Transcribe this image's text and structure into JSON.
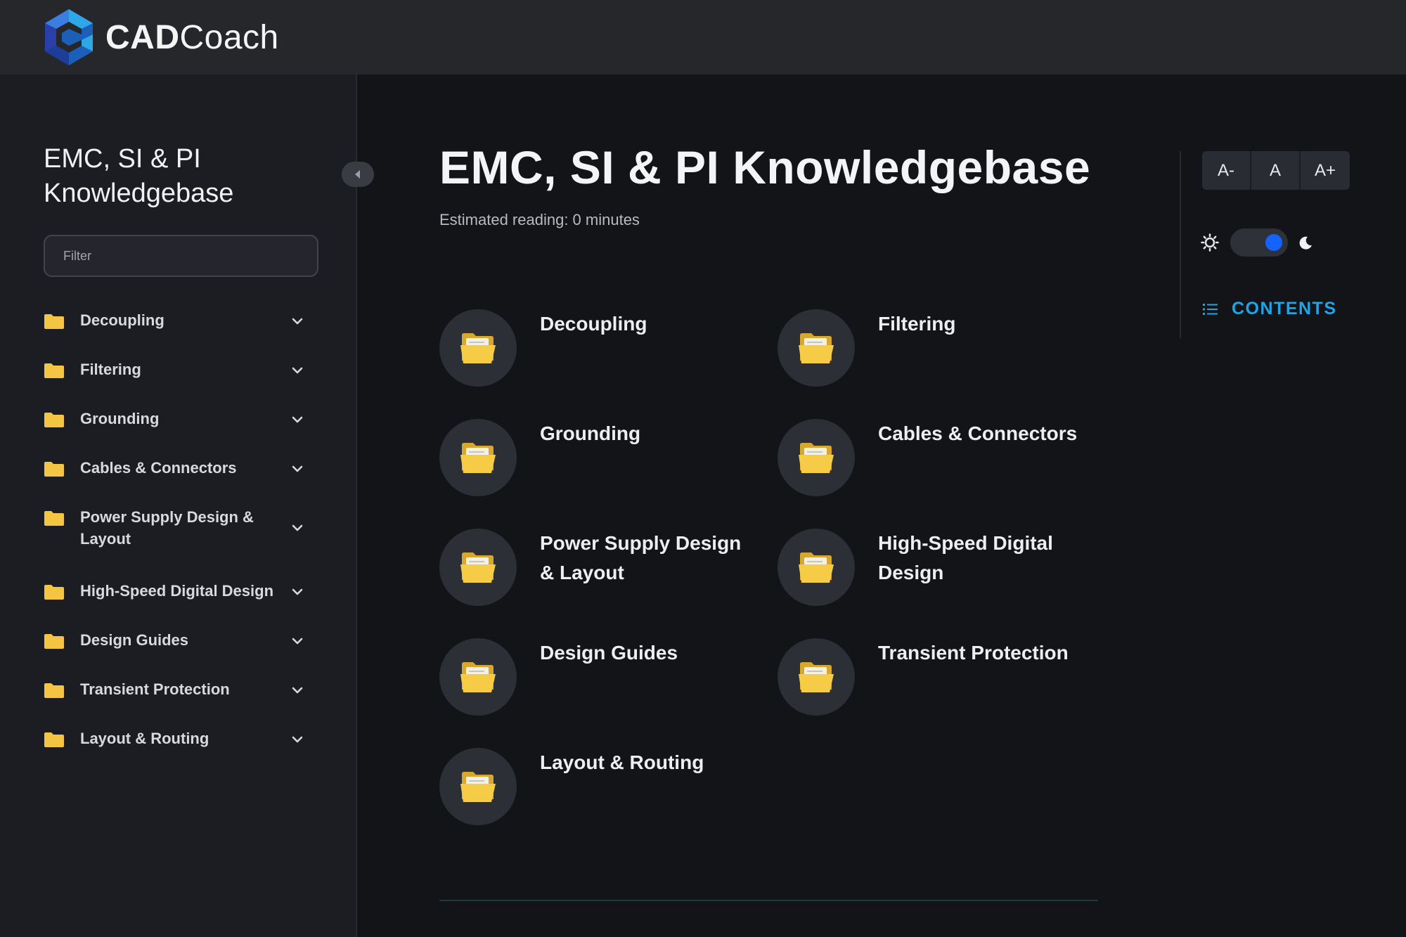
{
  "app": {
    "brand_bold": "CAD",
    "brand_light": "Coach"
  },
  "sidebar": {
    "title": "EMC, SI & PI Knowledgebase",
    "filter_placeholder": "Filter",
    "filter_value": "",
    "items": [
      {
        "label": "Decoupling"
      },
      {
        "label": "Filtering"
      },
      {
        "label": "Grounding"
      },
      {
        "label": "Cables & Connectors"
      },
      {
        "label": "Power Supply Design & Layout"
      },
      {
        "label": "High-Speed Digital Design"
      },
      {
        "label": "Design Guides"
      },
      {
        "label": "Transient Protection"
      },
      {
        "label": "Layout & Routing"
      }
    ]
  },
  "main": {
    "title": "EMC, SI & PI Knowledgebase",
    "reading": "Estimated reading: 0 minutes",
    "cards": [
      {
        "label": "Decoupling"
      },
      {
        "label": "Filtering"
      },
      {
        "label": "Grounding"
      },
      {
        "label": "Cables & Connectors"
      },
      {
        "label": "Power Supply Design & Layout"
      },
      {
        "label": "High-Speed Digital Design"
      },
      {
        "label": "Design Guides"
      },
      {
        "label": "Transient Protection"
      },
      {
        "label": "Layout & Routing"
      }
    ]
  },
  "rail": {
    "font_smaller": "A-",
    "font_reset": "A",
    "font_larger": "A+",
    "theme": "dark",
    "contents_label": "CONTENTS"
  },
  "icons": {
    "folder": "folder-icon",
    "chevron": "chevron-down-icon",
    "sun": "sun-icon",
    "moon": "moon-icon",
    "list": "list-icon"
  },
  "colors": {
    "accent": "#1ea5e8",
    "toggle": "#1463ff",
    "folder": "#f4c542"
  }
}
